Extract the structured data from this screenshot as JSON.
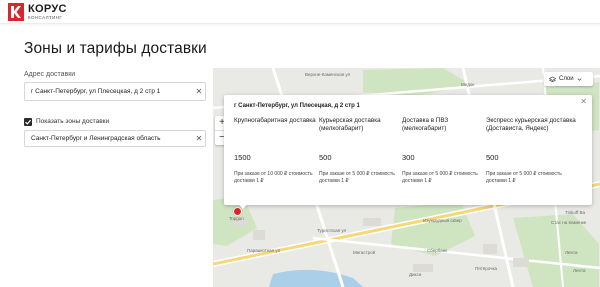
{
  "header": {
    "logo_main": "КОРУС",
    "logo_sub": "КОНСАЛТИНГ"
  },
  "page": {
    "title": "Зоны и тарифы доставки"
  },
  "address": {
    "label": "Адрес доставки",
    "value": "г Санкт-Петербург, ул Плесецкая, д 2 стр 1",
    "clear": "✕"
  },
  "zones": {
    "checked": true,
    "label": "Показать зоны доставки",
    "region_value": "Санкт-Петербург и Ленинградская область",
    "clear": "✕"
  },
  "map": {
    "layers_label": "Слои",
    "zoom_in": "+",
    "zoom_out": "−",
    "labels": {
      "street1": "Верхне-Каменская ул",
      "street2": "Парашютная ул",
      "street3": "Туристская ул",
      "poi1": "Медок",
      "poi2": "Лес",
      "poi3": "Лента",
      "poi4": "Topgun",
      "poi5": "Tinkoff Ba",
      "poi6": "Сбербанк",
      "poi7": "Изумрудный сквер",
      "poi8": "Стас на Каменке",
      "poi9": "Лента",
      "poi10": "Пятёрочка",
      "poi11": "Мегастрой",
      "poi12": "Дикси"
    },
    "popup": {
      "title": "г Санкт-Петербург, ул Плесецкая, д 2 стр 1",
      "close": "✕",
      "services": [
        {
          "name": "Крупногабаритная доставка",
          "price": "1500",
          "note": "При заказе от 10 000 ₽ стоимость доставки 1 ₽"
        },
        {
          "name": "Курьерская доставка (мелкогабарит)",
          "price": "500",
          "note": "При заказе от 5 000 ₽ стоимость доставки 1 ₽"
        },
        {
          "name": "Доставка в ПВЗ (мелкогабарит)",
          "price": "300",
          "note": "При заказе от 5 000 ₽ стоимость доставки 1 ₽"
        },
        {
          "name": "Экспресс курьерская доставка (Достависта, Яндекс)",
          "price": "500",
          "note": "При заказе от 5 000 ₽ стоимость доставки 1 ₽"
        }
      ]
    }
  },
  "colors": {
    "brand_red": "#d9262d",
    "map_bg": "#e9e9e6",
    "park_green": "#cfe5c2",
    "water_blue": "#a9d0e8"
  }
}
